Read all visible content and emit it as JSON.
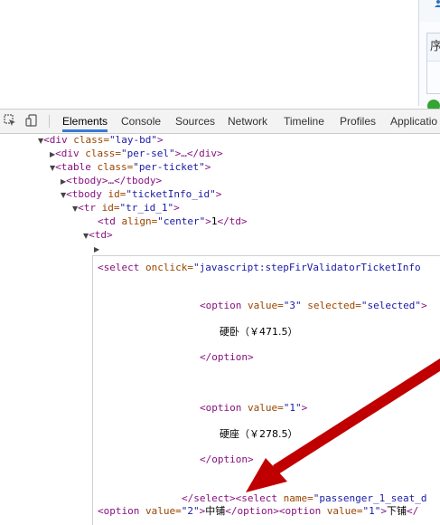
{
  "page_panel": {
    "header_text": "序"
  },
  "devtools": {
    "tabs": [
      "Elements",
      "Console",
      "Sources",
      "Network",
      "Timeline",
      "Profiles",
      "Applicatio"
    ],
    "active_tab": "Elements"
  },
  "dom_tree": {
    "l1_tag": "<div",
    "l1_attr": " class=",
    "l1_val": "\"lay-bd\"",
    "l1_close": ">",
    "l2_tag": "<div",
    "l2_attr": " class=",
    "l2_val": "\"per-sel\"",
    "l2_close": ">…</div>",
    "l3_tag": "<table",
    "l3_attr": " class=",
    "l3_val": "\"per-ticket\"",
    "l3_close": ">",
    "l4_text": "<tbody>…</tbody>",
    "l5_tag": "<tbody",
    "l5_attr": " id=",
    "l5_val": "\"ticketInfo_id\"",
    "l5_close": ">",
    "l6_tag": "<tr",
    "l6_attr": " id=",
    "l6_val": "\"tr_id_1\"",
    "l6_close": ">",
    "l7_tag": "<td",
    "l7_attr": " align=",
    "l7_val": "\"center\"",
    "l7_mid": ">",
    "l7_text": "1",
    "l7_close": "</td>",
    "l8_text": "<td>"
  },
  "source": {
    "select_tag": "<select",
    "select_attr": " onclick=",
    "select_val": "\"javascript:stepFirValidatorTicketInfo",
    "opt3_tag": "<option",
    "opt3_attr1": " value=",
    "opt3_val1": "\"3\"",
    "opt3_attr2": " selected=",
    "opt3_val2": "\"selected\"",
    "opt3_close": ">",
    "opt3_text": "硬卧（￥471.5）",
    "opt3_end": "</option>",
    "opt1_tag": "<option",
    "opt1_attr": " value=",
    "opt1_val": "\"1\"",
    "opt1_close": ">",
    "opt1_text": "硬座（￥278.5）",
    "opt1_end": "</option>",
    "endsel_tag": "</select>",
    "sel2_tag": "<select",
    "sel2_attr": " name=",
    "sel2_val": "\"passenger_1_seat_d",
    "last_tag1": "<option",
    "last_attr1": " value=",
    "last_val1": "\"2\"",
    "last_gt1": ">",
    "last_text1": "中铺",
    "last_end1": "</option>",
    "last_tag2": "<option",
    "last_attr2": " value=",
    "last_val2": "\"1\"",
    "last_gt2": ">",
    "last_text2": "下铺",
    "last_end2": "</"
  },
  "colors": {
    "tag": "#881280",
    "attr": "#994500",
    "value": "#1a1aa6",
    "arrow": "#c00000",
    "tab_accent": "#3879d9"
  },
  "icons": [
    "inspect-element-icon",
    "device-mode-icon",
    "person-icon",
    "expand-triangle-icon"
  ]
}
